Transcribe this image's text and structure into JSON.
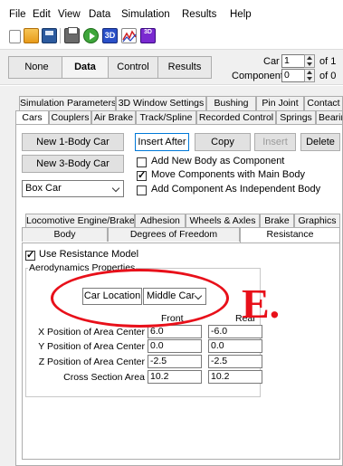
{
  "menu": [
    "File",
    "Edit",
    "View",
    "Data",
    "Simulation",
    "Results",
    "Help"
  ],
  "toolbar": {
    "icons": [
      "new-file-icon",
      "open-folder-icon",
      "save-icon",
      "print-icon",
      "run-icon",
      "3d-view-icon",
      "graph-icon",
      "3d-graph-icon"
    ],
    "threed_text": "3D",
    "threedf_text": "3D"
  },
  "modes": {
    "none": "None",
    "data": "Data",
    "control": "Control",
    "results": "Results",
    "car_label": "Car",
    "car_value": "1",
    "car_of": "of 1",
    "component_label": "Component",
    "component_value": "0",
    "component_of": "of 0"
  },
  "tabs_row1": [
    "Simulation Parameters",
    "3D Window Settings",
    "Bushing",
    "Pin Joint",
    "Contact"
  ],
  "tabs_row2": [
    "Cars",
    "Couplers",
    "Air Brake",
    "Track/Spline",
    "Recorded Control",
    "Springs",
    "Bearings"
  ],
  "cars_page": {
    "new_1body": "New 1-Body Car",
    "new_3body": "New 3-Body Car",
    "insert_after": "Insert After",
    "copy": "Copy",
    "insert": "Insert",
    "delete": "Delete",
    "car_type": "Box Car",
    "checks": [
      {
        "label": "Add New Body as Component",
        "checked": false
      },
      {
        "label": "Move Components with Main Body",
        "checked": true
      },
      {
        "label": "Add Component As Independent Body",
        "checked": false
      }
    ]
  },
  "subtabs_row1": [
    "Locomotive Engine/Brake",
    "Adhesion",
    "Wheels & Axles",
    "Brake",
    "Graphics"
  ],
  "subtabs_row2": [
    "Body",
    "Degrees of Freedom",
    "Resistance"
  ],
  "resistance": {
    "use_model_label": "Use Resistance Model",
    "use_model_checked": true,
    "group_title": "Aerodynamics Properties",
    "car_location_label": "Car Location",
    "car_location_value": "Middle Car",
    "col_front": "Front",
    "col_rear": "Rear",
    "rows": [
      {
        "label": "X Position of Area Center",
        "front": "6.0",
        "rear": "-6.0"
      },
      {
        "label": "Y Position of Area Center",
        "front": "0.0",
        "rear": "0.0"
      },
      {
        "label": "Z Position of Area Center",
        "front": "-2.5",
        "rear": "-2.5"
      },
      {
        "label": "Cross Section Area",
        "front": "10.2",
        "rear": "10.2"
      }
    ]
  },
  "annotation": {
    "letter": "E.",
    "color": "#e8101a"
  }
}
